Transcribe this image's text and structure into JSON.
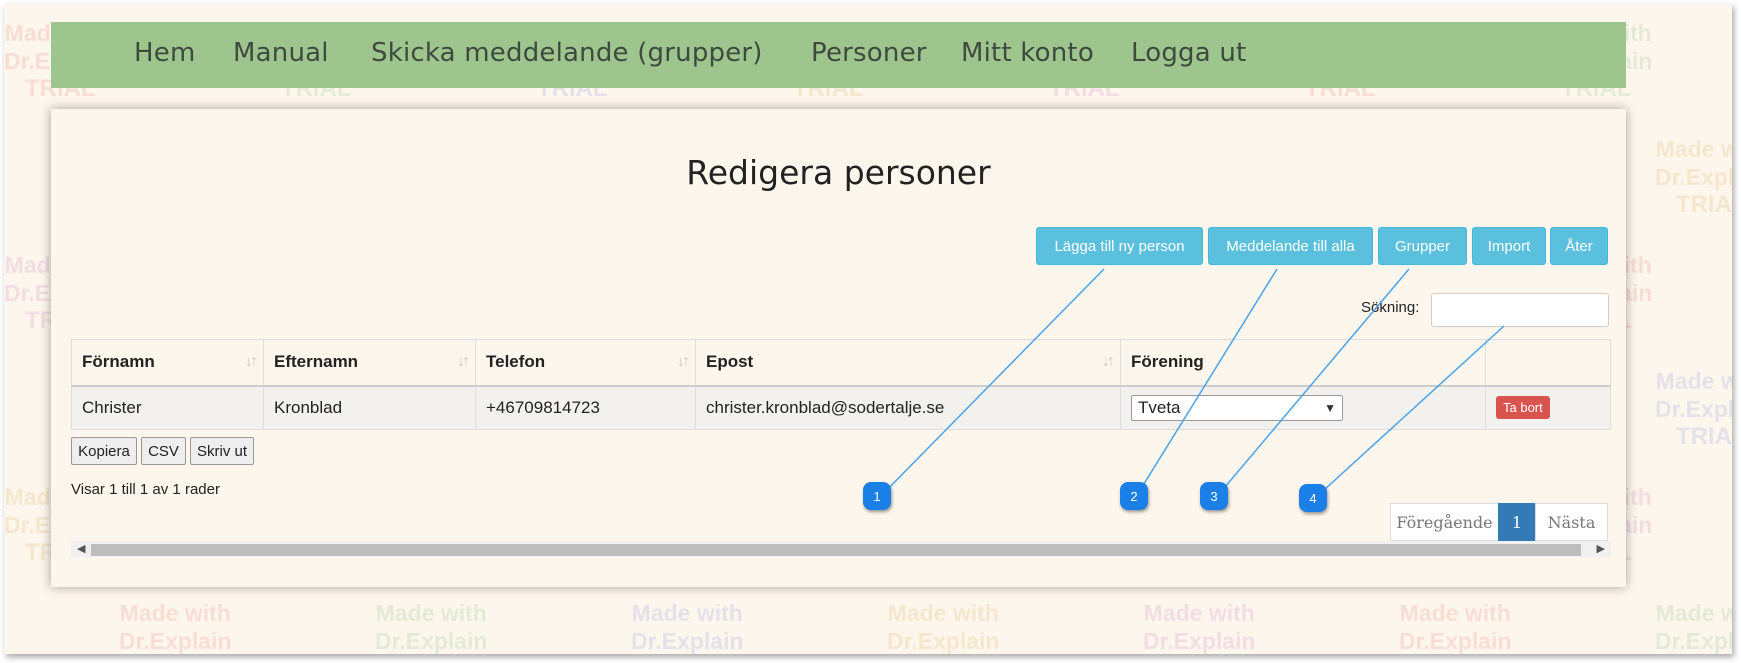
{
  "nav": {
    "items": [
      "Hem",
      "Manual",
      "Skicka meddelande (grupper)",
      "Personer",
      "Mitt konto",
      "Logga ut"
    ]
  },
  "page": {
    "title": "Redigera personer"
  },
  "toolbar": {
    "add_person": "Lägga till ny person",
    "message_all": "Meddelande till alla",
    "groups": "Grupper",
    "import": "Import",
    "back": "Åter"
  },
  "search": {
    "label": "Sökning:",
    "value": ""
  },
  "table": {
    "columns": [
      "Förnamn",
      "Efternamn",
      "Telefon",
      "Epost",
      "Förening",
      ""
    ],
    "rows": [
      {
        "first_name": "Christer",
        "last_name": "Kronblad",
        "phone": "+46709814723",
        "email": "christer.kronblad@sodertalje.se",
        "association": "Tveta",
        "delete_label": "Ta bort"
      }
    ]
  },
  "table_tools": {
    "copy": "Kopiera",
    "csv": "CSV",
    "print": "Skriv ut"
  },
  "info": "Visar 1 till 1 av 1 rader",
  "pagination": {
    "prev": "Föregående",
    "current": "1",
    "next": "Nästa"
  },
  "watermark": {
    "line1": "Made with",
    "line2": "Dr.Explain",
    "line3": "TRIAL"
  },
  "callouts": [
    "1",
    "2",
    "3",
    "4"
  ],
  "colors": {
    "nav_bg": "#9fc58f",
    "button_info": "#5bc0de",
    "button_danger": "#d9534f",
    "pager_active": "#337ab7",
    "callout": "#1a7fe6"
  }
}
